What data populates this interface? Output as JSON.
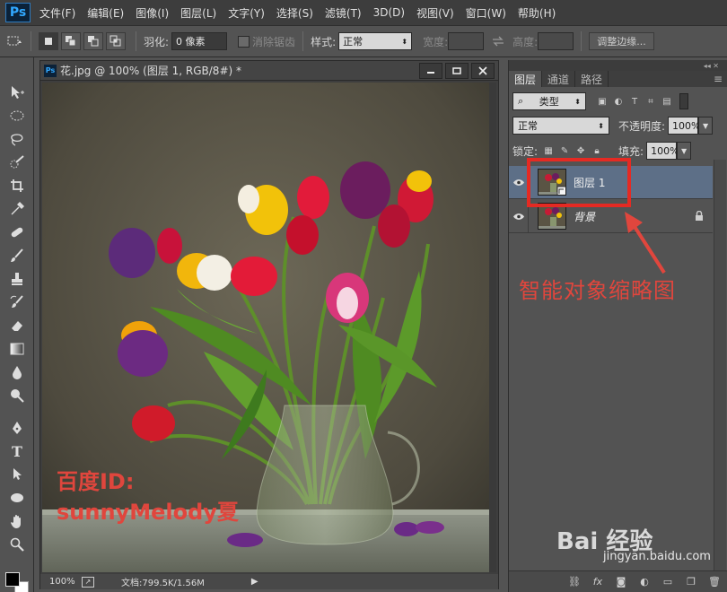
{
  "menubar": {
    "logo": "Ps",
    "items": [
      "文件(F)",
      "编辑(E)",
      "图像(I)",
      "图层(L)",
      "文字(Y)",
      "选择(S)",
      "滤镜(T)",
      "3D(D)",
      "视图(V)",
      "窗口(W)",
      "帮助(H)"
    ]
  },
  "options": {
    "feather_label": "羽化:",
    "feather_value": "0 像素",
    "antialias_label": "消除锯齿",
    "style_label": "样式:",
    "style_value": "正常",
    "width_label": "宽度:",
    "height_label": "高度:",
    "refine_button": "调整边缘..."
  },
  "document": {
    "title": "花.jpg @ 100% (图层 1, RGB/8#) *",
    "zoom": "100%",
    "doc_info": "文档:799.5K/1.56M",
    "overlay_id_line1": "百度ID:",
    "overlay_id_line2": "sunnyMelody夏"
  },
  "panel": {
    "tabs": [
      "图层",
      "通道",
      "路径"
    ],
    "filter_kind": "类型",
    "blend_mode": "正常",
    "opacity_label": "不透明度:",
    "opacity_value": "100%",
    "lock_label": "锁定:",
    "fill_label": "填充:",
    "fill_value": "100%",
    "layers": [
      {
        "name": "图层 1",
        "selected": true
      },
      {
        "name": "背景",
        "selected": false
      }
    ]
  },
  "annotation": {
    "callout_text": "智能对象缩略图",
    "arrow_color": "#e0463d",
    "box_color": "#e52a23"
  },
  "watermark": {
    "brand": "Bai 经验",
    "url": "jingyan.baidu.com"
  }
}
